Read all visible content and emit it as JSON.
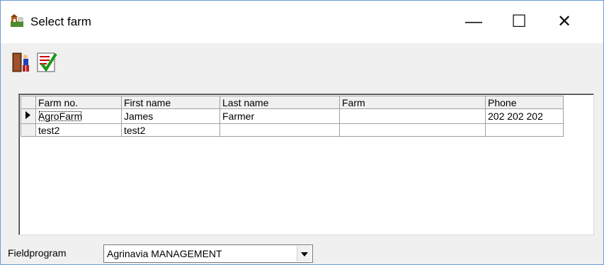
{
  "window": {
    "title": "Select farm",
    "minimize": "—",
    "maximize": "☐",
    "close": "✕"
  },
  "toolbar": {
    "exit_icon": "exit-door-icon",
    "ok_icon": "confirm-check-icon"
  },
  "grid": {
    "columns": [
      "Farm no.",
      "First name",
      "Last name",
      "Farm",
      "Phone"
    ],
    "rows": [
      [
        "AgroFarm",
        "James",
        "Farmer",
        "",
        "202 202 202"
      ],
      [
        "test2",
        "test2",
        "",
        "",
        ""
      ]
    ],
    "selected_row": 0
  },
  "footer": {
    "label": "Fieldprogram",
    "combo_value": "Agrinavia MANAGEMENT"
  }
}
